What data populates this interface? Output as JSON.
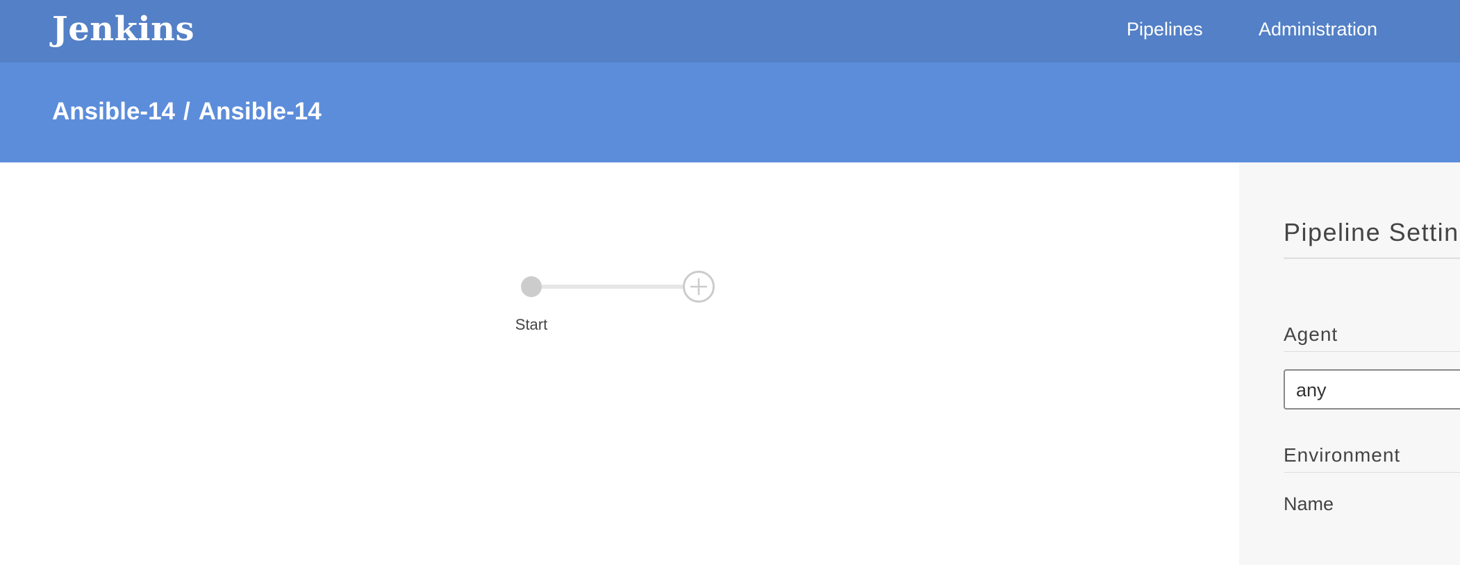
{
  "header": {
    "logo": "Jenkins",
    "nav": [
      "Pipelines",
      "Administration"
    ]
  },
  "breadcrumb": {
    "parts": [
      "Ansible-14",
      "Ansible-14"
    ],
    "separator": "/"
  },
  "editor": {
    "start_label": "Start",
    "add_stage_icon": "plus-circle-icon"
  },
  "settings": {
    "title": "Pipeline Settings",
    "agent_label": "Agent",
    "agent_value": "any",
    "environment_label": "Environment",
    "name_label": "Name"
  },
  "colors": {
    "topbar": "#5380c6",
    "subheader": "#5c8ddb",
    "panel_bg": "#f7f7f7",
    "node_gray": "#cccccc"
  }
}
